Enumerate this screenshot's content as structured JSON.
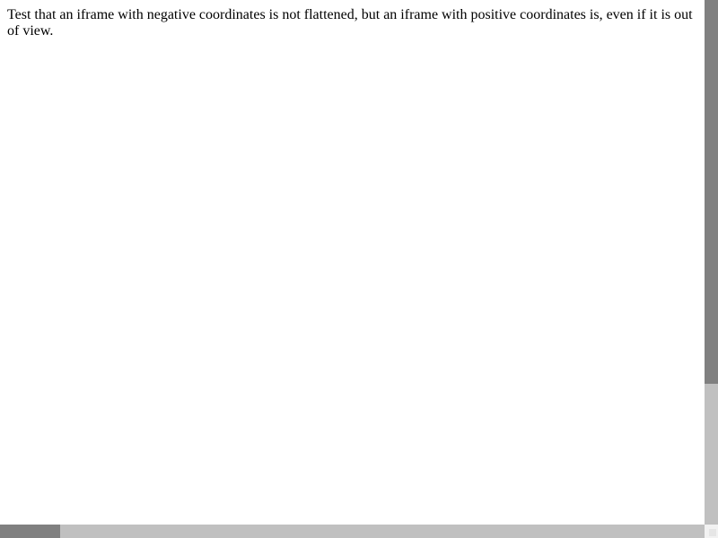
{
  "page": {
    "description": "Test that an iframe with negative coordinates is not flattened, but an iframe with positive coordinates is, even if it is out of view."
  },
  "scrollbars": {
    "vertical": {
      "position_fraction": 0.0,
      "visible_fraction": 0.73
    },
    "horizontal": {
      "position_fraction": 0.0,
      "visible_fraction": 0.085
    }
  },
  "colors": {
    "background": "#ffffff",
    "text": "#000000",
    "scrollbar_track": "#c0c0c0",
    "scrollbar_thumb": "#808080"
  }
}
